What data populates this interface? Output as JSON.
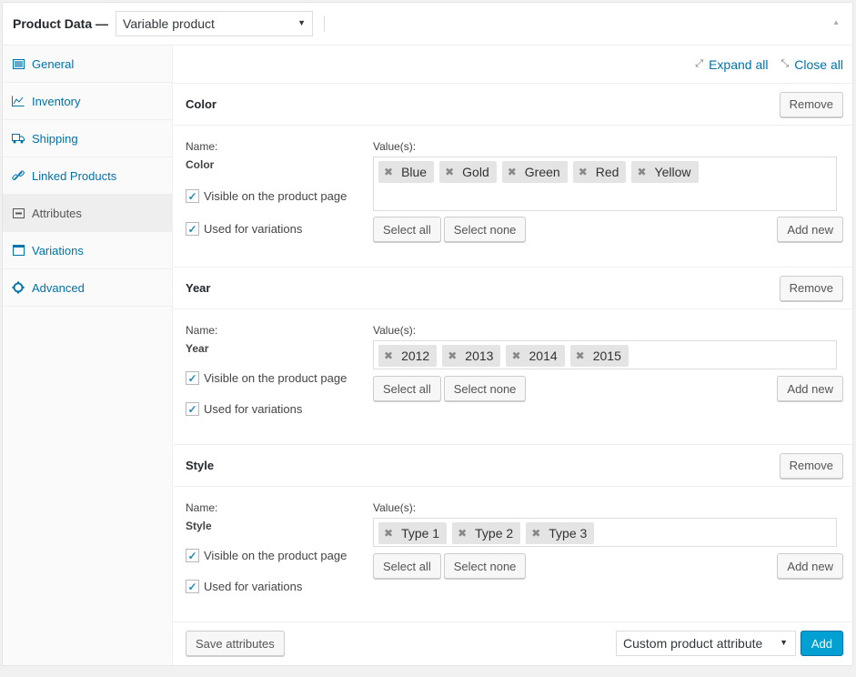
{
  "header": {
    "title": "Product Data —",
    "product_type": "Variable product"
  },
  "tabs": [
    {
      "label": "General",
      "icon": "general-icon"
    },
    {
      "label": "Inventory",
      "icon": "inventory-icon"
    },
    {
      "label": "Shipping",
      "icon": "shipping-icon"
    },
    {
      "label": "Linked Products",
      "icon": "link-icon"
    },
    {
      "label": "Attributes",
      "icon": "attributes-icon",
      "active": true
    },
    {
      "label": "Variations",
      "icon": "variations-icon"
    },
    {
      "label": "Advanced",
      "icon": "gear-icon"
    }
  ],
  "toolbar": {
    "expand_all": "Expand all",
    "close_all": "Close all"
  },
  "labels": {
    "name": "Name:",
    "values": "Value(s):",
    "visible": "Visible on the product page",
    "used_for_variations": "Used for variations",
    "remove": "Remove",
    "select_all": "Select all",
    "select_none": "Select none",
    "add_new": "Add new"
  },
  "attributes": [
    {
      "name": "Color",
      "values": [
        "Blue",
        "Gold",
        "Green",
        "Red",
        "Yellow"
      ],
      "visible": true,
      "variations": true
    },
    {
      "name": "Year",
      "values": [
        "2012",
        "2013",
        "2014",
        "2015"
      ],
      "visible": true,
      "variations": true
    },
    {
      "name": "Style",
      "values": [
        "Type 1",
        "Type 2",
        "Type 3"
      ],
      "visible": true,
      "variations": true
    }
  ],
  "footer": {
    "save_label": "Save attributes",
    "attribute_select": "Custom product attribute",
    "add_label": "Add"
  },
  "colors": {
    "link": "#0073aa",
    "primary_button": "#00a0d2"
  }
}
